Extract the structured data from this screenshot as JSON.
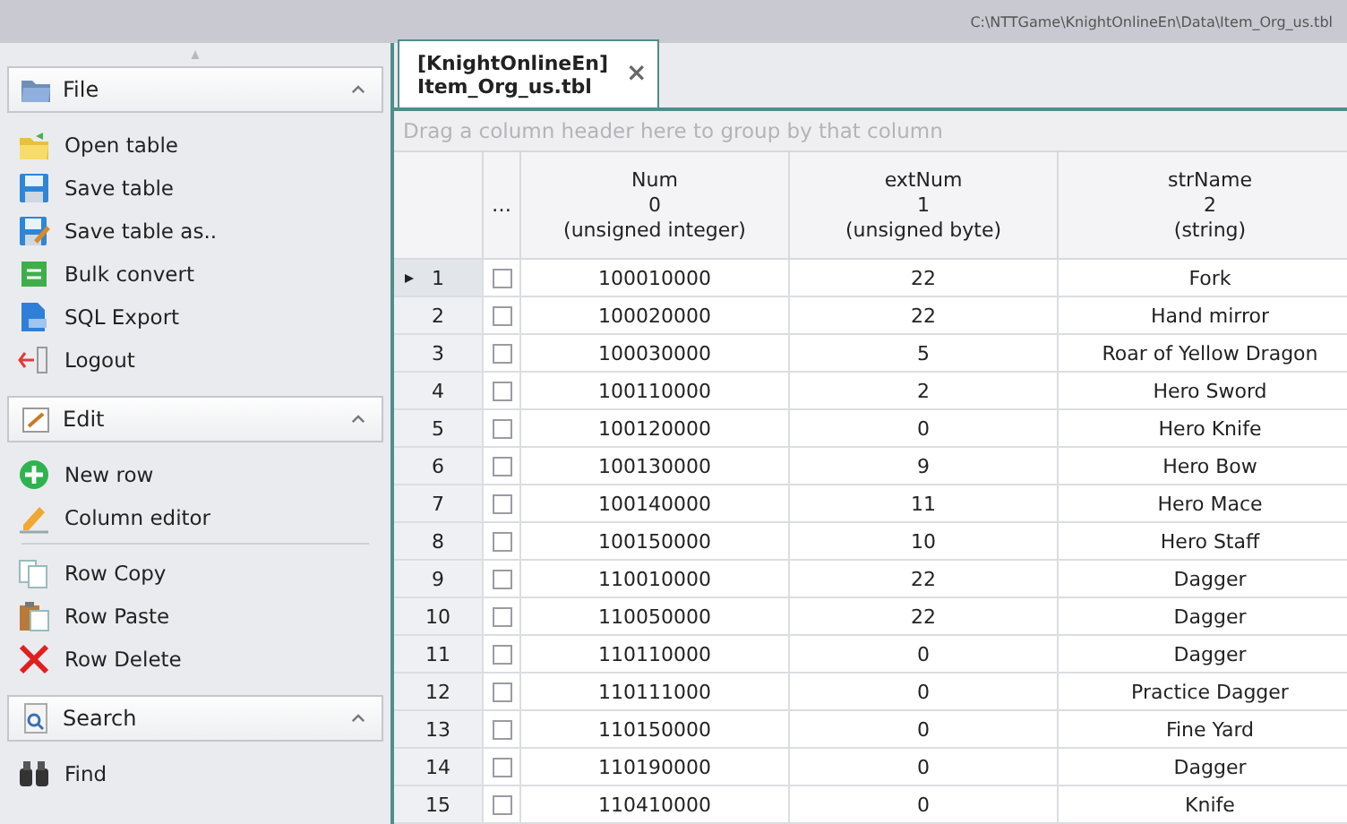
{
  "title_bar": {
    "path": "C:\\NTTGame\\KnightOnlineEn\\Data\\Item_Org_us.tbl"
  },
  "sidebar": {
    "groups": [
      {
        "title": "File",
        "expanded": true,
        "sections": [
          [
            {
              "label": "Open table"
            },
            {
              "label": "Save table"
            },
            {
              "label": "Save table as.."
            },
            {
              "label": "Bulk convert"
            },
            {
              "label": "SQL Export"
            },
            {
              "label": "Logout"
            }
          ]
        ]
      },
      {
        "title": "Edit",
        "expanded": true,
        "sections": [
          [
            {
              "label": "New row"
            },
            {
              "label": "Column editor"
            }
          ],
          [
            {
              "label": "Row Copy"
            },
            {
              "label": "Row Paste"
            },
            {
              "label": "Row Delete"
            }
          ]
        ]
      },
      {
        "title": "Search",
        "expanded": true,
        "sections": [
          [
            {
              "label": "Find"
            }
          ]
        ]
      }
    ]
  },
  "tabs": [
    {
      "label": "[KnightOnlineEn]\nItem_Org_us.tbl",
      "selected": true,
      "close": "×"
    }
  ],
  "group_panel": {
    "placeholder": "Drag a column header here to group by that column"
  },
  "table": {
    "select_column": "…",
    "columns": [
      {
        "name": "Num",
        "index": "0",
        "type": "(unsigned integer)"
      },
      {
        "name": "extNum",
        "index": "1",
        "type": "(unsigned byte)"
      },
      {
        "name": "strName",
        "index": "2",
        "type": "(string)"
      }
    ],
    "rows": [
      {
        "number": "1",
        "selected": true,
        "checked": false,
        "cells": [
          "100010000",
          "22",
          "Fork"
        ]
      },
      {
        "number": "2",
        "selected": false,
        "checked": false,
        "cells": [
          "100020000",
          "22",
          "Hand mirror"
        ]
      },
      {
        "number": "3",
        "selected": false,
        "checked": false,
        "cells": [
          "100030000",
          "5",
          "Roar of Yellow Dragon"
        ]
      },
      {
        "number": "4",
        "selected": false,
        "checked": false,
        "cells": [
          "100110000",
          "2",
          "Hero Sword"
        ]
      },
      {
        "number": "5",
        "selected": false,
        "checked": false,
        "cells": [
          "100120000",
          "0",
          "Hero Knife"
        ]
      },
      {
        "number": "6",
        "selected": false,
        "checked": false,
        "cells": [
          "100130000",
          "9",
          "Hero Bow"
        ]
      },
      {
        "number": "7",
        "selected": false,
        "checked": false,
        "cells": [
          "100140000",
          "11",
          "Hero Mace"
        ]
      },
      {
        "number": "8",
        "selected": false,
        "checked": false,
        "cells": [
          "100150000",
          "10",
          "Hero Staff"
        ]
      },
      {
        "number": "9",
        "selected": false,
        "checked": false,
        "cells": [
          "110010000",
          "22",
          "Dagger"
        ]
      },
      {
        "number": "10",
        "selected": false,
        "checked": false,
        "cells": [
          "110050000",
          "22",
          "Dagger"
        ]
      },
      {
        "number": "11",
        "selected": false,
        "checked": false,
        "cells": [
          "110110000",
          "0",
          "Dagger"
        ]
      },
      {
        "number": "12",
        "selected": false,
        "checked": false,
        "cells": [
          "110111000",
          "0",
          "Practice Dagger"
        ]
      },
      {
        "number": "13",
        "selected": false,
        "checked": false,
        "cells": [
          "110150000",
          "0",
          "Fine Yard"
        ]
      },
      {
        "number": "14",
        "selected": false,
        "checked": false,
        "cells": [
          "110190000",
          "0",
          "Dagger"
        ]
      },
      {
        "number": "15",
        "selected": false,
        "checked": false,
        "cells": [
          "110410000",
          "0",
          "Knife"
        ]
      }
    ]
  }
}
